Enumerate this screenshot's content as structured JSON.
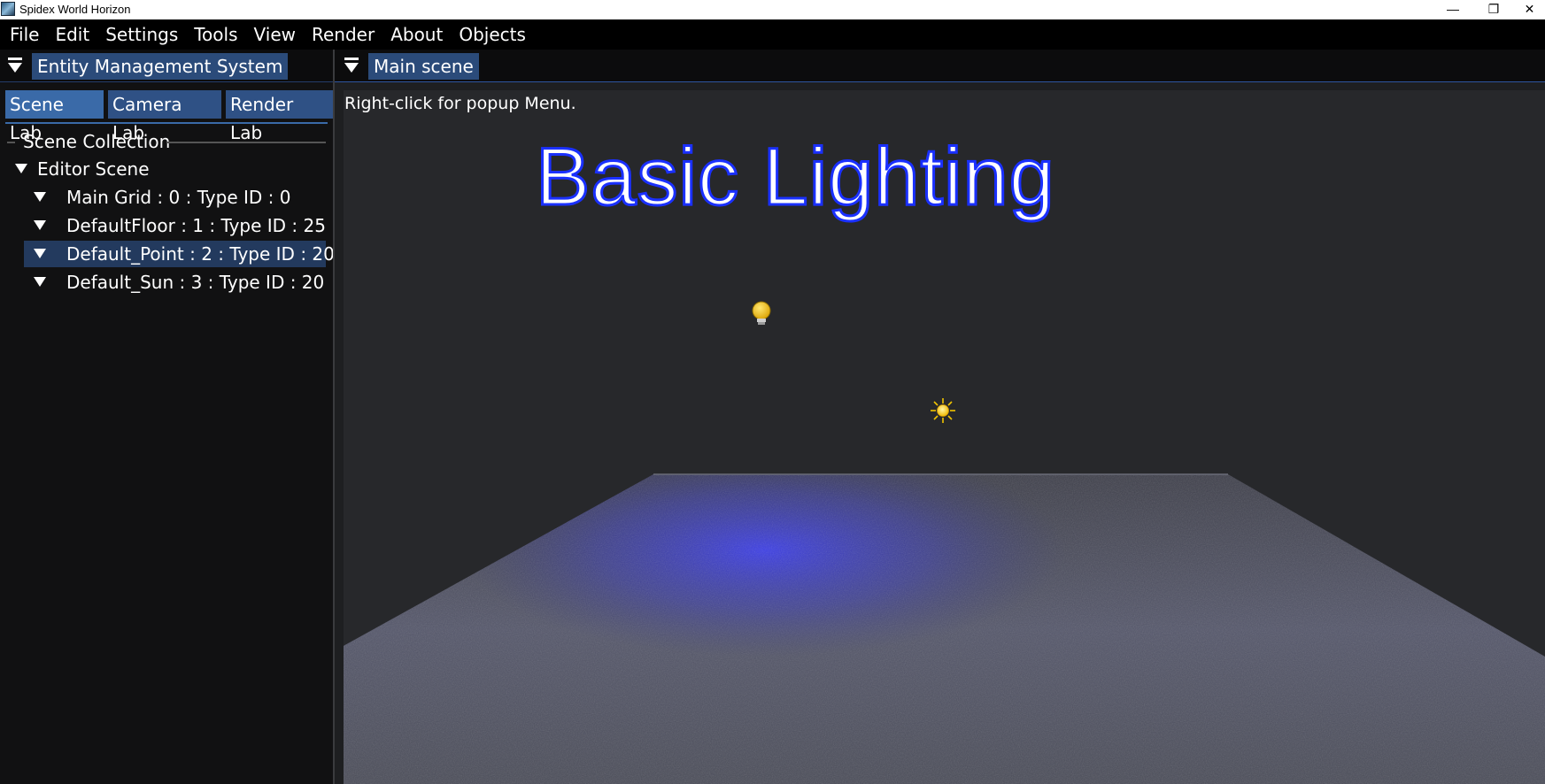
{
  "window": {
    "title": "Spidex World Horizon",
    "controls": {
      "minimize": "—",
      "maximize": "❐",
      "close": "✕"
    }
  },
  "menu": [
    "File",
    "Edit",
    "Settings",
    "Tools",
    "View",
    "Render",
    "About",
    "Objects"
  ],
  "left_panel": {
    "title": "Entity Management System",
    "tabs": [
      "Scene Lab",
      "Camera Lab",
      "Render Lab"
    ],
    "section_label": "Scene Collection",
    "tree": {
      "root": "Editor Scene",
      "items": [
        "Main Grid : 0 : Type ID : 0",
        "DefaultFloor : 1 : Type ID : 25",
        "Default_Point : 2 : Type ID : 20",
        "Default_Sun : 3 : Type ID : 20"
      ],
      "selected_index": 2
    }
  },
  "main_panel": {
    "title": "Main scene",
    "hint": "Right-click for popup Menu.",
    "scene_title": "Basic Lighting",
    "icons": [
      "point-light-bulb-icon",
      "sun-light-icon"
    ]
  },
  "colors": {
    "accent_tab": "#3a6aa8",
    "panel_title": "#2b4b7a",
    "scene_title_outline": "#1a30ff",
    "point_light_glow": "#3a3cff"
  }
}
